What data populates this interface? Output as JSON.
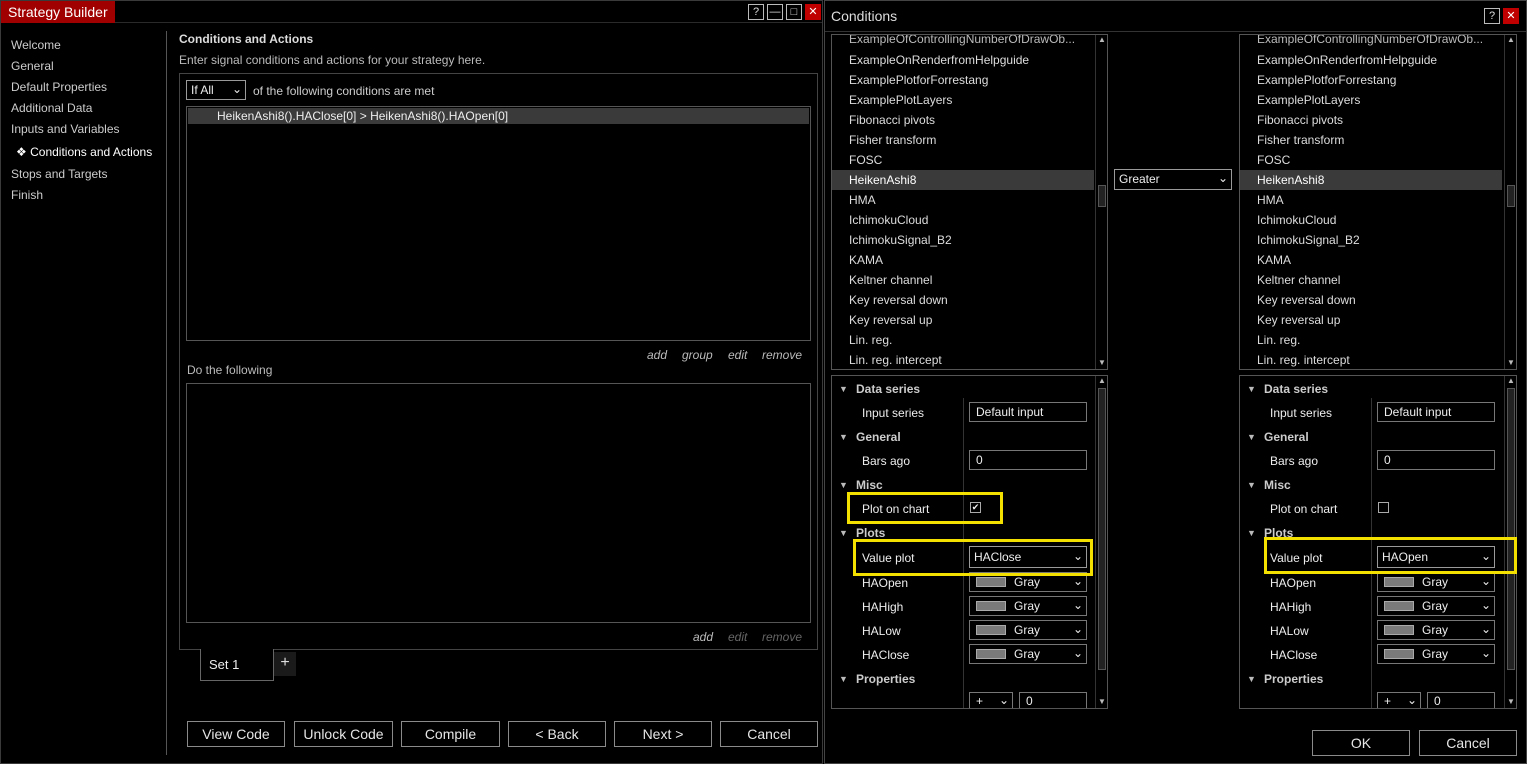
{
  "strategy_builder": {
    "title": "Strategy Builder",
    "window_buttons": [
      "?",
      "—",
      "□",
      "✕"
    ],
    "nav": [
      "Welcome",
      "General",
      "Default Properties",
      "Additional Data",
      "Inputs and Variables",
      "Conditions and Actions",
      "Stops and Targets",
      "Finish"
    ],
    "nav_marker": "❖",
    "heading": "Conditions and Actions",
    "subheading": "Enter signal conditions and actions for your strategy here.",
    "if_select": "If All",
    "if_suffix": "of the following conditions are met",
    "condition_row": "HeikenAshi8().HAClose[0] > HeikenAshi8().HAOpen[0]",
    "cond_links": [
      "add",
      "group",
      "edit",
      "remove"
    ],
    "do_following": "Do the following",
    "action_links": [
      "add",
      "edit",
      "remove"
    ],
    "set_tab": "Set 1",
    "add_set": "+",
    "buttons": [
      "View Code",
      "Unlock Code",
      "Compile",
      "< Back",
      "Next >",
      "Cancel"
    ]
  },
  "conditions": {
    "title": "Conditions",
    "window_buttons": [
      "?",
      "✕"
    ],
    "indicator_list_cut": "ExampleOfControllingNumberOfDrawOb...",
    "indicator_list": [
      "ExampleOnRenderfromHelpguide",
      "ExamplePlotforForrestang",
      "ExamplePlotLayers",
      "Fibonacci pivots",
      "Fisher transform",
      "FOSC",
      "HeikenAshi8",
      "HMA",
      "IchimokuCloud",
      "IchimokuSignal_B2",
      "KAMA",
      "Keltner channel",
      "Key reversal down",
      "Key reversal up",
      "Lin. reg.",
      "Lin. reg. intercept"
    ],
    "selected_indicator": "HeikenAshi8",
    "operator": "Greater",
    "left": {
      "data_series_h": "Data series",
      "input_series_l": "Input series",
      "input_series_v": "Default input",
      "general_h": "General",
      "bars_ago_l": "Bars ago",
      "bars_ago_v": "0",
      "misc_h": "Misc",
      "plot_on_chart_l": "Plot on chart",
      "plot_on_chart_v": "✔",
      "plots_h": "Plots",
      "value_plot_l": "Value plot",
      "value_plot_v": "HAClose",
      "plot_rows": [
        {
          "label": "HAOpen",
          "color": "Gray"
        },
        {
          "label": "HAHigh",
          "color": "Gray"
        },
        {
          "label": "HALow",
          "color": "Gray"
        },
        {
          "label": "HAClose",
          "color": "Gray"
        }
      ],
      "properties_h": "Properties",
      "offset_op": "+",
      "offset_v": "0"
    },
    "right": {
      "data_series_h": "Data series",
      "input_series_l": "Input series",
      "input_series_v": "Default input",
      "general_h": "General",
      "bars_ago_l": "Bars ago",
      "bars_ago_v": "0",
      "misc_h": "Misc",
      "plot_on_chart_l": "Plot on chart",
      "plot_on_chart_v": "",
      "plots_h": "Plots",
      "value_plot_l": "Value plot",
      "value_plot_v": "HAOpen",
      "plot_rows": [
        {
          "label": "HAOpen",
          "color": "Gray"
        },
        {
          "label": "HAHigh",
          "color": "Gray"
        },
        {
          "label": "HALow",
          "color": "Gray"
        },
        {
          "label": "HAClose",
          "color": "Gray"
        }
      ],
      "properties_h": "Properties",
      "offset_op": "+",
      "offset_v": "0"
    },
    "ok": "OK",
    "cancel": "Cancel"
  },
  "colors": {
    "title_red": "#a00000",
    "highlight": "#f4e000",
    "swatch_gray": "#7a7a7a"
  }
}
